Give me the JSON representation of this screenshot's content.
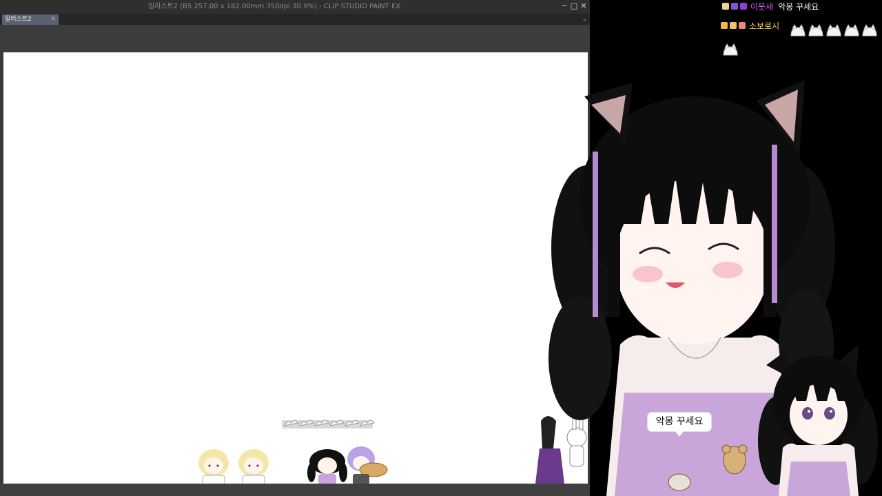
{
  "window": {
    "title": "일러스트2 (B5 257.00 x 182.00mm 350dpi 30.9%)  - CLIP STUDIO PAINT EX",
    "minimize_glyph": "─",
    "maximize_glyph": "□",
    "close_glyph": "✕"
  },
  "tabs": [
    {
      "label": "일러스트2",
      "close_glyph": "✕"
    }
  ],
  "tab_menu_glyph": "⌄",
  "chat": [
    {
      "user": "이웃새",
      "user_color": "#e05cff",
      "message": "악몽 꾸세요"
    },
    {
      "user": "소보로시",
      "user_color": "#ffd36a",
      "message": ""
    }
  ],
  "speech_bubble": {
    "text": "악몽 꾸세요"
  }
}
